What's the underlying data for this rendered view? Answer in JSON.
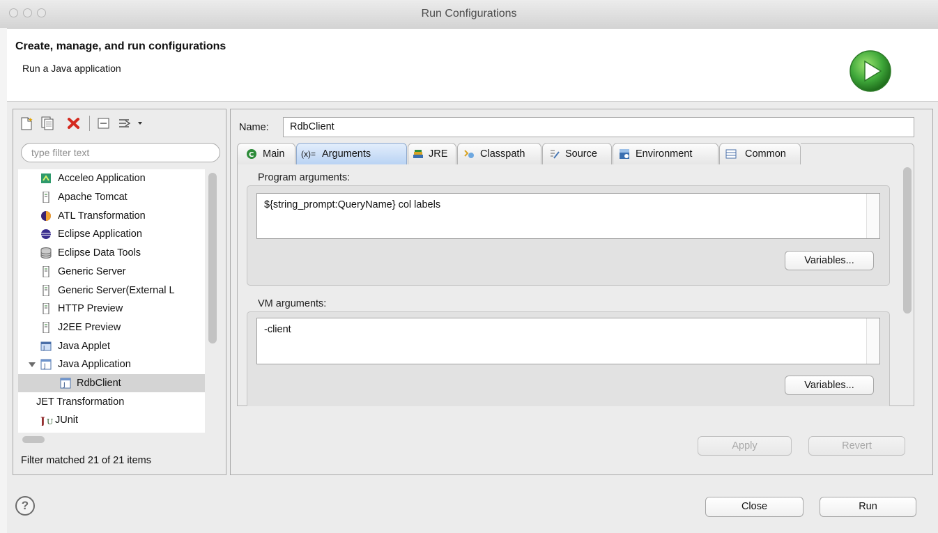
{
  "window": {
    "title": "Run Configurations"
  },
  "header": {
    "title": "Create, manage, and run configurations",
    "subtitle": "Run a Java application"
  },
  "left_panel": {
    "toolbar_icons": [
      "new-config-icon",
      "duplicate-icon",
      "delete-icon",
      "collapse-all-icon",
      "filter-icon"
    ],
    "filter_placeholder": "type filter text",
    "tree": [
      {
        "label": "Acceleo Application",
        "icon": "acceleo-icon"
      },
      {
        "label": "Apache Tomcat",
        "icon": "server-icon"
      },
      {
        "label": "ATL Transformation",
        "icon": "atl-icon"
      },
      {
        "label": "Eclipse Application",
        "icon": "eclipse-icon"
      },
      {
        "label": "Eclipse Data Tools",
        "icon": "database-icon"
      },
      {
        "label": "Generic Server",
        "icon": "server-icon"
      },
      {
        "label": "Generic Server(External L",
        "icon": "server-icon"
      },
      {
        "label": "HTTP Preview",
        "icon": "server-icon"
      },
      {
        "label": "J2EE Preview",
        "icon": "server-icon"
      },
      {
        "label": "Java Applet",
        "icon": "applet-icon"
      },
      {
        "label": "Java Application",
        "icon": "java-app-icon",
        "expanded": true
      },
      {
        "label": "RdbClient",
        "icon": "java-app-icon",
        "selected": true
      },
      {
        "label": "JET Transformation",
        "icon": ""
      },
      {
        "label": "JUnit",
        "icon": "junit-icon"
      }
    ],
    "filter_status": "Filter matched 21 of 21 items"
  },
  "right_panel": {
    "name_label": "Name:",
    "name_value": "RdbClient",
    "tabs": [
      {
        "label": "Main",
        "icon": "main-icon",
        "active": false
      },
      {
        "label": "Arguments",
        "icon": "arguments-icon",
        "active": true
      },
      {
        "label": "JRE",
        "icon": "jre-icon",
        "active": false
      },
      {
        "label": "Classpath",
        "icon": "classpath-icon",
        "active": false
      },
      {
        "label": "Source",
        "icon": "source-icon",
        "active": false
      },
      {
        "label": "Environment",
        "icon": "environment-icon",
        "active": false
      },
      {
        "label": "Common",
        "icon": "common-icon",
        "active": false
      }
    ],
    "arguments_icon_text": "(x)=",
    "program_args": {
      "label": "Program arguments:",
      "value": "${string_prompt:QueryName} col labels",
      "variables_label": "Variables..."
    },
    "vm_args": {
      "label": "VM arguments:",
      "value": "-client",
      "variables_label": "Variables..."
    },
    "apply_label": "Apply",
    "revert_label": "Revert"
  },
  "footer": {
    "help_label": "?",
    "close_label": "Close",
    "run_label": "Run"
  },
  "colors": {
    "accent_green": "#3fa83a",
    "active_tab": "#b8d2f3",
    "delete_red": "#d42a1f"
  }
}
